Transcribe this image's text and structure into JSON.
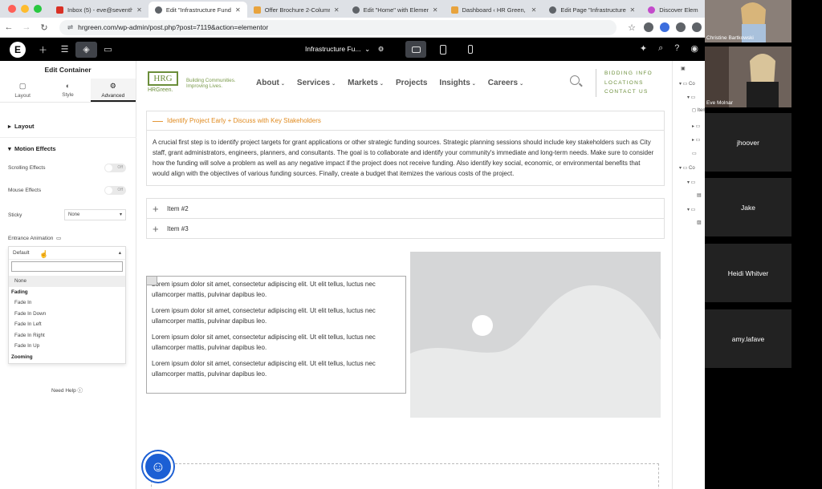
{
  "browser": {
    "tabs": [
      {
        "label": "Inbox (5) - eve@seventhe",
        "color": "#d93025"
      },
      {
        "label": "Edit \"Infrastructure Fund",
        "color": "#5f6368"
      },
      {
        "label": "Offer Brochure 2-Column",
        "color": "#e8a33d"
      },
      {
        "label": "Edit \"Home\" with Elementor",
        "color": "#5f6368"
      },
      {
        "label": "Dashboard ‹ HR Green, Inc",
        "color": "#e8a33d"
      },
      {
        "label": "Edit Page \"Infrastructure F",
        "color": "#5f6368"
      },
      {
        "label": "Discover Elem",
        "color": "#c34acb"
      }
    ],
    "url": "hrgreen.com/wp-admin/post.php?post=7119&action=elementor"
  },
  "editor": {
    "page_name": "Infrastructure Fu...",
    "logo": "E"
  },
  "panel": {
    "title": "Edit Container",
    "tabs": [
      {
        "label": "Layout",
        "icon": "▢"
      },
      {
        "label": "Style",
        "icon": "◐"
      },
      {
        "label": "Advanced",
        "icon": "⚙"
      }
    ],
    "layout_section": "Layout",
    "motion_section": "Motion Effects",
    "scrolling_effects": "Scrolling Effects",
    "mouse_effects": "Mouse Effects",
    "toggle_off": "Off",
    "sticky": "Sticky",
    "sticky_value": "None",
    "entrance_animation": "Entrance Animation",
    "animation_value": "Default",
    "dropdown_items": [
      {
        "label": "None",
        "group": false
      },
      {
        "label": "Fading",
        "group": true
      },
      {
        "label": "Fade In",
        "group": false
      },
      {
        "label": "Fade In Down",
        "group": false
      },
      {
        "label": "Fade In Left",
        "group": false
      },
      {
        "label": "Fade In Right",
        "group": false
      },
      {
        "label": "Fade In Up",
        "group": false
      },
      {
        "label": "Zooming",
        "group": true
      }
    ],
    "need_help": "Need Help"
  },
  "site": {
    "logo_text": "HRG",
    "logo_sub": "HRGreen.",
    "tagline_1": "Building Communities.",
    "tagline_2": "Improving Lives.",
    "nav": [
      {
        "label": "About",
        "caret": true
      },
      {
        "label": "Services",
        "caret": true
      },
      {
        "label": "Markets",
        "caret": true
      },
      {
        "label": "Projects",
        "caret": false
      },
      {
        "label": "Insights",
        "caret": true
      },
      {
        "label": "Careers",
        "caret": true
      }
    ],
    "util_links": [
      "BIDDING INFO",
      "LOCATIONS",
      "CONTACT US"
    ]
  },
  "accordion": {
    "open_title": "Identify Project Early + Discuss with Key Stakeholders",
    "open_body": "A crucial first step is to identify project targets for grant applications or other strategic funding sources. Strategic planning sessions should include key stakeholders such as City staff, grant administrators, engineers, planners, and consultants. The goal is to collaborate and identify your community's immediate and long-term needs. Make sure to consider how the funding will solve a problem as well as any negative impact if the project does not receive funding. Also identify key social, economic, or environmental benefits that would align with the objectives of various funding sources. Finally, create a budget that itemizes the various costs of the project.",
    "item2": "Item #2",
    "item3": "Item #3"
  },
  "text_block": {
    "paragraphs": [
      "Lorem ipsum dolor sit amet, consectetur adipiscing elit. Ut elit tellus, luctus nec ullamcorper mattis, pulvinar dapibus leo.",
      "Lorem ipsum dolor sit amet, consectetur adipiscing elit. Ut elit tellus, luctus nec ullamcorper mattis, pulvinar dapibus leo.",
      "Lorem ipsum dolor sit amet, consectetur adipiscing elit. Ut elit tellus, luctus nec ullamcorper mattis, pulvinar dapibus leo.",
      "Lorem ipsum dolor sit amet, consectetur adipiscing elit. Ut elit tellus, luctus nec ullamcorper mattis, pulvinar dapibus leo."
    ]
  },
  "navigator": {
    "rows": [
      "Co",
      "Co",
      "Item #1",
      "",
      "",
      "",
      "Co",
      "",
      "",
      "",
      ""
    ]
  },
  "video_call": {
    "participants": [
      {
        "name": "Christine Bartkowski",
        "video": true
      },
      {
        "name": "Eve Molnar",
        "video": true
      },
      {
        "name": "jhoover",
        "video": false
      },
      {
        "name": "Jake",
        "video": false
      },
      {
        "name": "Heidi Whitver",
        "video": false
      },
      {
        "name": "amy.lafave",
        "video": false
      }
    ]
  },
  "colors": {
    "brand_green": "#6b8e3a",
    "accordion_accent": "#e08a1e",
    "a11y_blue": "#1c5fd4"
  }
}
